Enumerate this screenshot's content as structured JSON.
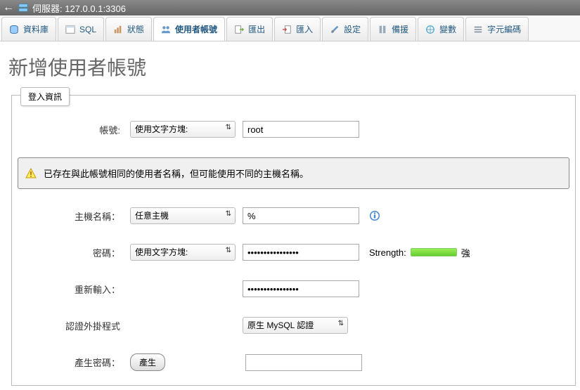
{
  "topbar": {
    "server_label": "伺服器: 127.0.0.1:3306"
  },
  "tabs": [
    {
      "label": "資料庫",
      "icon": "database"
    },
    {
      "label": "SQL",
      "icon": "sql"
    },
    {
      "label": "狀態",
      "icon": "status"
    },
    {
      "label": "使用者帳號",
      "icon": "users",
      "active": true
    },
    {
      "label": "匯出",
      "icon": "export"
    },
    {
      "label": "匯入",
      "icon": "import"
    },
    {
      "label": "設定",
      "icon": "settings"
    },
    {
      "label": "備援",
      "icon": "replication"
    },
    {
      "label": "變數",
      "icon": "variables"
    },
    {
      "label": "字元編碼",
      "icon": "charset"
    }
  ],
  "page_title": "新增使用者帳號",
  "fieldset_label": "登入資訊",
  "form": {
    "username_label": "帳號:",
    "username_mode": "使用文字方塊:",
    "username_value": "root",
    "warning": "已存在與此帳號相同的使用者名稱，但可能使用不同的主機名稱。",
    "host_label": "主機名稱：",
    "host_mode": "任意主機",
    "host_value": "%",
    "password_label": "密碼：",
    "password_mode": "使用文字方塊:",
    "password_value": "••••••••••••••••",
    "strength_label": "Strength:",
    "strength_text": "強",
    "retype_label": "重新輸入：",
    "retype_value": "••••••••••••••••",
    "auth_label": "認證外掛程式",
    "auth_value": "原生 MySQL 認證",
    "gen_label": "產生密碼：",
    "gen_button": "產生",
    "gen_value": ""
  }
}
